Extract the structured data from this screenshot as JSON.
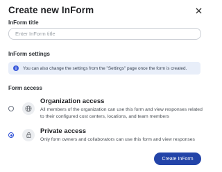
{
  "dialog": {
    "title": "Create new InForm",
    "title_field": {
      "label": "InForm title",
      "value": "",
      "placeholder": "Enter InForm title"
    },
    "settings": {
      "label": "InForm settings",
      "info_text": "You can also change the settings from the \"Settings\" page once the form is created."
    },
    "access": {
      "label": "Form access",
      "options": [
        {
          "title": "Organization access",
          "description": "All members of the organization can use this form and view responses related to their configured cost centers, locations, and team members",
          "selected": false,
          "icon": "globe-icon"
        },
        {
          "title": "Private access",
          "description": "Only form owners and collaborators can use this form and view responses",
          "selected": true,
          "icon": "lock-icon"
        }
      ]
    },
    "submit_label": "Create InForm",
    "colors": {
      "primary": "#2344a8",
      "info_banner_bg": "#e8eef9",
      "info_icon": "#3b5bdb"
    }
  }
}
